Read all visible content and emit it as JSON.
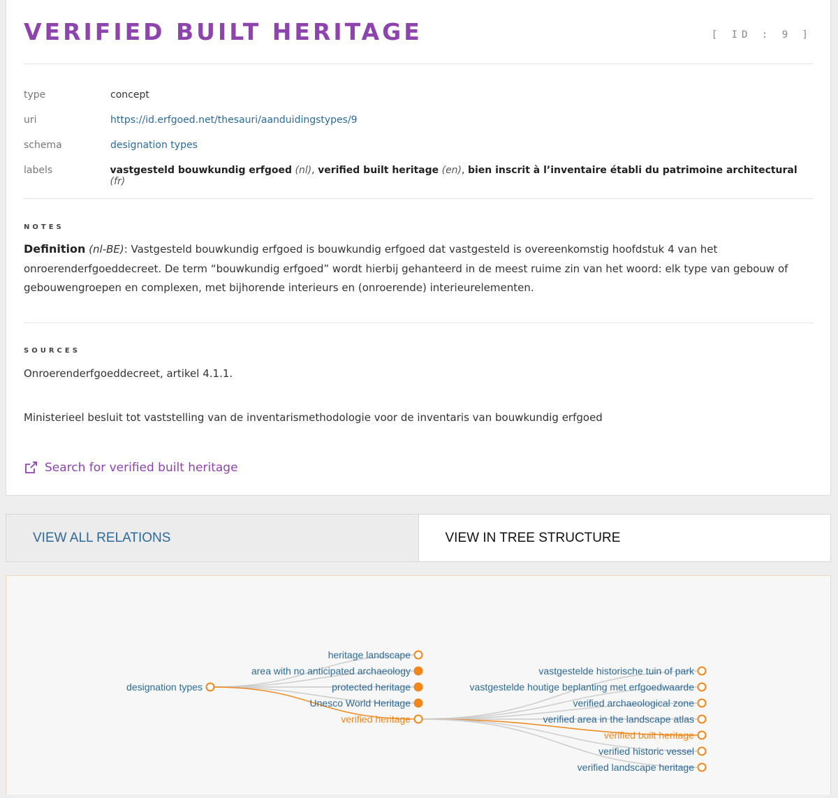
{
  "header": {
    "title": "Verified Built Heritage",
    "id_label": "[ ID : 9 ]"
  },
  "properties": {
    "type": {
      "key": "type",
      "value": "concept"
    },
    "uri": {
      "key": "uri",
      "value": "https://id.erfgoed.net/thesauri/aanduidingstypes/9"
    },
    "schema": {
      "key": "schema",
      "value": "designation types"
    },
    "labels": {
      "key": "labels",
      "items": [
        {
          "text": "vastgesteld bouwkundig erfgoed",
          "lang": "(nl)",
          "sep": ", "
        },
        {
          "text": "verified built heritage",
          "lang": "(en)",
          "sep": ", "
        },
        {
          "text": "bien inscrit à l’inventaire établi du patrimoine architectural",
          "lang": "(fr)",
          "sep": ""
        }
      ]
    }
  },
  "notes": {
    "heading": "Notes",
    "label": "Definition",
    "lang": "(nl-BE)",
    "text": ": Vastgesteld bouwkundig erfgoed is bouwkundig erfgoed dat vastgesteld is overeenkomstig hoofdstuk 4 van het onroerenderfgoeddecreet. De term “bouwkundig erfgoed” wordt hierbij gehanteerd in de meest ruime zin van het woord: elk type van gebouw of gebouwengroepen en complexen, met bijhorende interieurs en (onroerende) interieurelementen."
  },
  "sources": {
    "heading": "Sources",
    "items": [
      "Onroerenderfgoeddecreet, artikel 4.1.1.",
      "Ministerieel besluit tot vaststelling van de inventarismethodologie voor de inventaris van bouwkundig erfgoed"
    ]
  },
  "search_link": "Search for verified built heritage",
  "tabs": {
    "all_relations": "VIEW ALL RELATIONS",
    "tree_structure": "VIEW IN TREE STRUCTURE"
  },
  "colors": {
    "accent_purple": "#8e44ad",
    "link_blue": "#2d6a97",
    "tree_orange": "#f0871c",
    "tree_link_grey": "#cccccc"
  },
  "tree": {
    "root": {
      "label": "designation types"
    },
    "level1": [
      {
        "label": "heritage landscape",
        "filled": false,
        "active": false
      },
      {
        "label": "area with no anticipated archaeology",
        "filled": true,
        "active": false
      },
      {
        "label": "protected heritage",
        "filled": true,
        "active": false
      },
      {
        "label": "Unesco World Heritage",
        "filled": true,
        "active": false
      },
      {
        "label": "verified heritage",
        "filled": false,
        "active": true
      }
    ],
    "level2": [
      {
        "label": "vastgestelde historische tuin of park",
        "filled": false,
        "active": false
      },
      {
        "label": "vastgestelde houtige beplanting met erfgoedwaarde",
        "filled": false,
        "active": false
      },
      {
        "label": "verified archaeological zone",
        "filled": false,
        "active": false
      },
      {
        "label": "verified area in the landscape atlas",
        "filled": false,
        "active": false
      },
      {
        "label": "verified built heritage",
        "filled": false,
        "active": true
      },
      {
        "label": "verified historic vessel",
        "filled": false,
        "active": false
      },
      {
        "label": "verified landscape heritage",
        "filled": false,
        "active": false
      }
    ]
  }
}
